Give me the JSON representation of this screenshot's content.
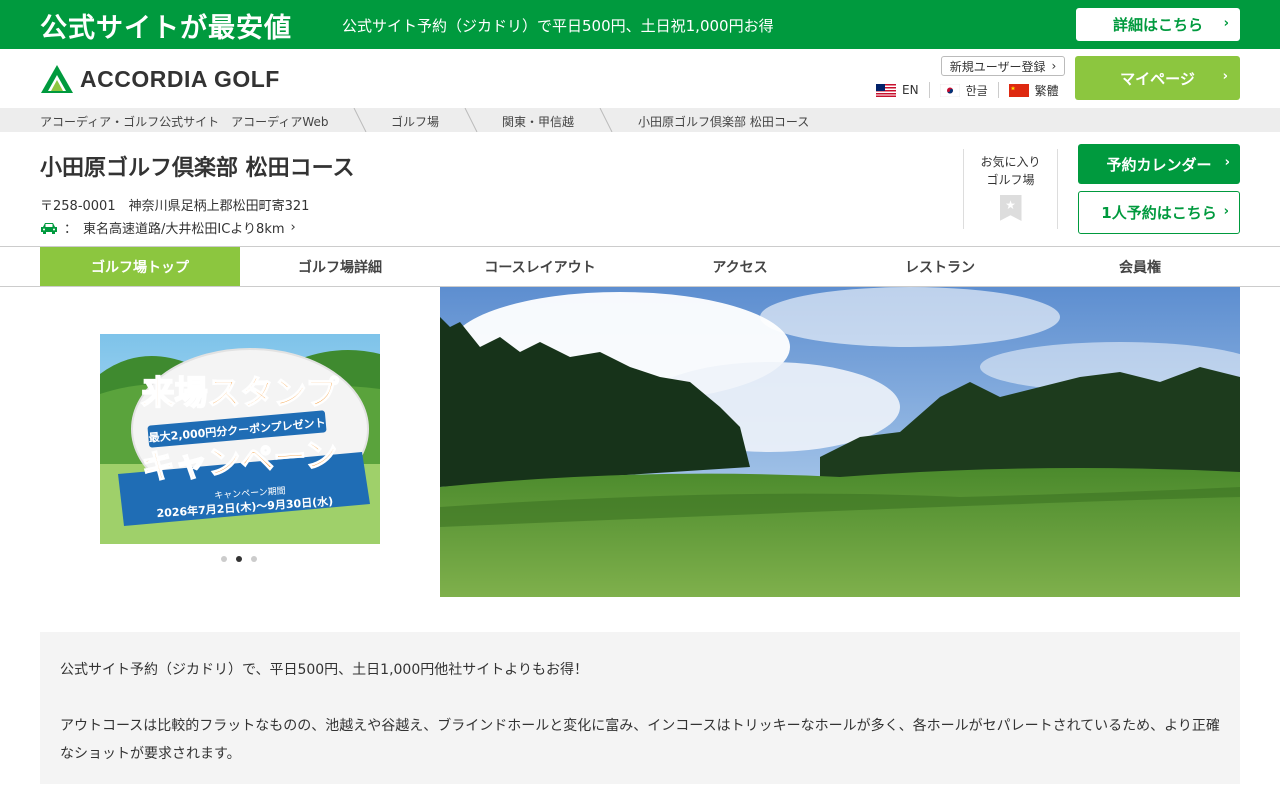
{
  "promo": {
    "title": "公式サイトが最安値",
    "text": "公式サイト予約（ジカドリ）で平日500円、土日祝1,000円お得",
    "button": "詳細はこちら"
  },
  "header": {
    "logo_text": "ACCORDIA GOLF",
    "register": "新規ユーザー登録",
    "languages": [
      "EN",
      "한글",
      "繁體"
    ],
    "mypage": "マイページ"
  },
  "breadcrumb": [
    "アコーディア・ゴルフ公式サイト　アコーディアWeb",
    "ゴルフ場",
    "関東・甲信越",
    "小田原ゴルフ倶楽部 松田コース"
  ],
  "course": {
    "name": "小田原ゴルフ倶楽部 松田コース",
    "address": "〒258-0001　神奈川県足柄上郡松田町寄321",
    "access_sep": "：",
    "access": "東名高速道路/大井松田ICより8km"
  },
  "favorite": {
    "line1": "お気に入り",
    "line2": "ゴルフ場"
  },
  "buttons": {
    "calendar": "予約カレンダー",
    "single": "1人予約はこちら"
  },
  "tabs": [
    "ゴルフ場トップ",
    "ゴルフ場詳細",
    "コースレイアウト",
    "アクセス",
    "レストラン",
    "会員権"
  ],
  "banner": {
    "title1": "来場スタンプ",
    "sub": "最大2,000円分クーポンプレゼント",
    "title2": "キャンペーン",
    "period_label": "キャンペーン期間",
    "period": "2026年7月2日(木)～9月30日(水)"
  },
  "carousel": {
    "count": 3,
    "active": 1
  },
  "description": [
    "公式サイト予約（ジカドリ）で、平日500円、土日1,000円他社サイトよりもお得！",
    "アウトコースは比較的フラットなものの、池越えや谷越え、ブラインドホールと変化に富み、インコースはトリッキーなホールが多く、各ホールがセパレートされているため、より正確なショットが要求されます。"
  ],
  "colors": {
    "brand_green": "#009a3e",
    "light_green": "#8cc63f"
  }
}
